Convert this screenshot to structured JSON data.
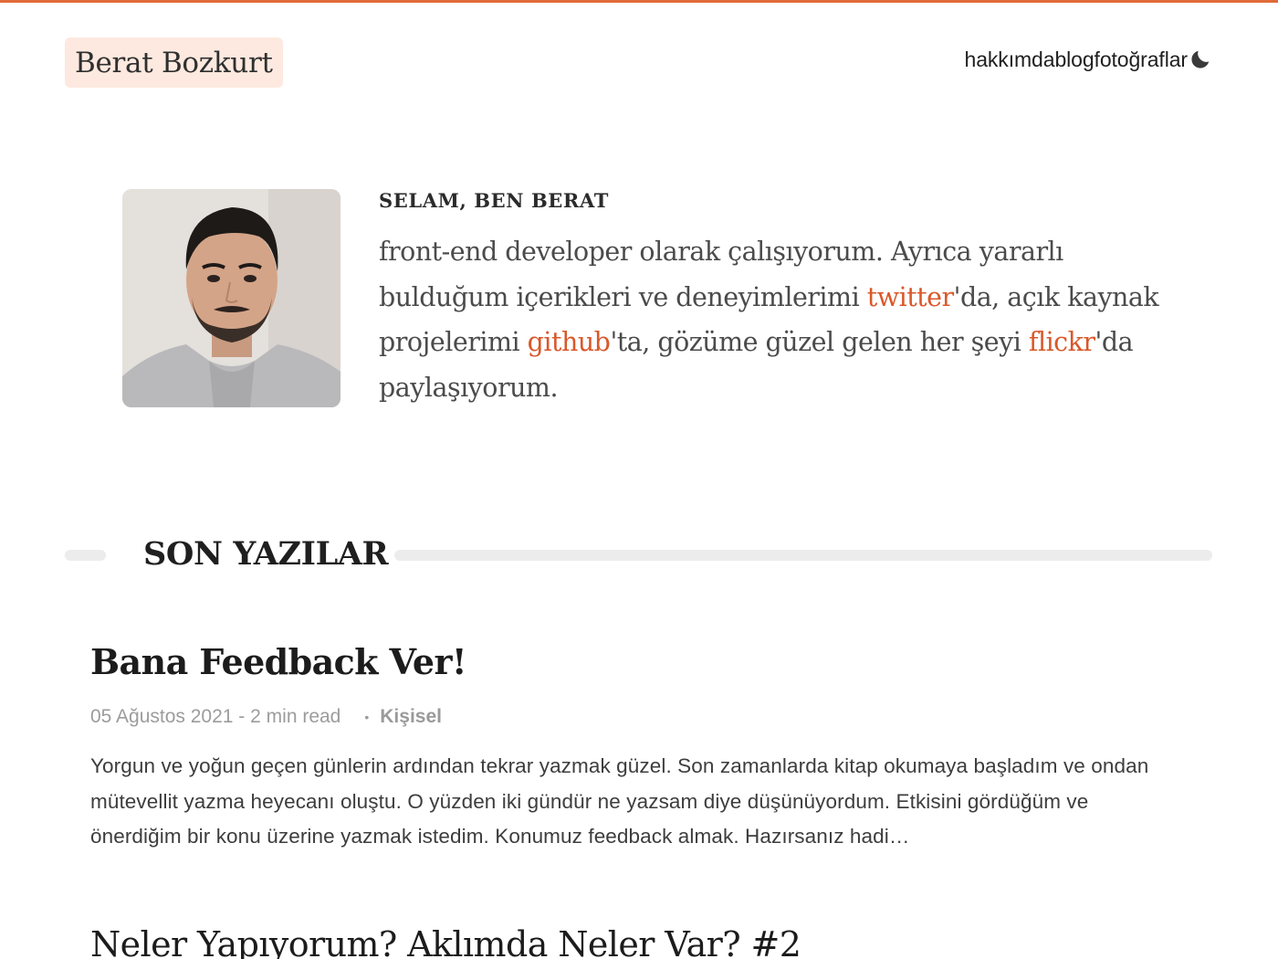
{
  "site": {
    "brand": "Berat Bozkurt",
    "accent_color": "#e06a3a",
    "link_color": "#d9582a",
    "brand_bg": "#fde9df"
  },
  "nav": {
    "items": [
      "hakkımda",
      "blog",
      "fotoğraflar"
    ],
    "theme_toggle_icon": "moon-icon"
  },
  "intro": {
    "avatar_alt": "profile photo",
    "greeting": "SELAM, BEN BERAT",
    "bio_part1": "front-end developer olarak çalışıyorum. Ayrıca yararlı bulduğum içerikleri ve deneyimlerimi ",
    "link_twitter": "twitter",
    "bio_part2": "'da, açık kaynak projelerimi ",
    "link_github": "github",
    "bio_part3": "'ta, gözüme güzel gelen her şeyi ",
    "link_flickr": "flickr",
    "bio_part4": "'da paylaşıyorum."
  },
  "section": {
    "title": "SON YAZILAR"
  },
  "posts": [
    {
      "title": "Bana Feedback Ver!",
      "date": "05 Ağustos 2021",
      "read_time": "2 min read",
      "meta_sep": " - ",
      "bullet": "•",
      "category": "Kişisel",
      "excerpt": "Yorgun ve yoğun geçen günlerin ardından tekrar yazmak güzel. Son zamanlarda kitap okumaya başladım ve ondan mütevellit yazma heyecanı oluştu. O yüzden iki gündür ne yazsam diye düşünüyordum. Etkisini gördüğüm ve önerdiğim bir konu üzerine yazmak istedim. Konumuz feedback almak. Hazırsanız hadi…"
    },
    {
      "title": "Neler Yapıyorum? Aklımda Neler Var? #2"
    }
  ]
}
